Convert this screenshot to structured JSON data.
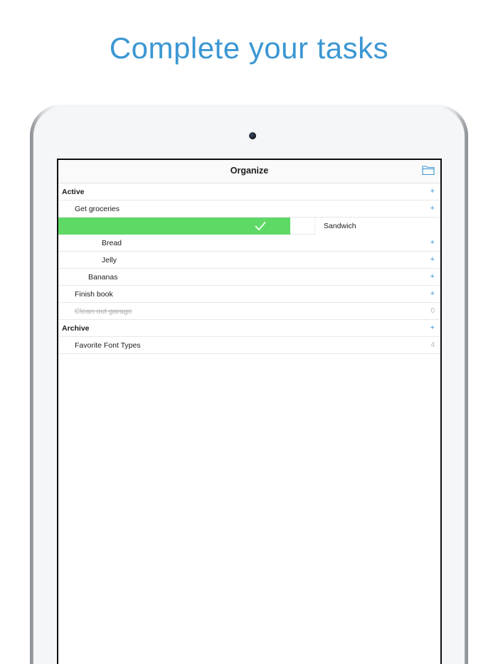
{
  "headline": "Complete your tasks",
  "app": {
    "title": "Organize",
    "folder_icon": "folder-icon"
  },
  "colors": {
    "accent": "#3b97d3",
    "swipe_complete": "#5fd966"
  },
  "list": {
    "active_header": "Active",
    "active_add": "+",
    "groceries": {
      "label": "Get groceries",
      "add": "+"
    },
    "sandwich": {
      "label": "Sandwich",
      "swipe_icon": "check-icon"
    },
    "bread": {
      "label": "Bread",
      "add": "+"
    },
    "jelly": {
      "label": "Jelly",
      "add": "+"
    },
    "bananas": {
      "label": "Bananas",
      "add": "+"
    },
    "finish_book": {
      "label": "Finish book",
      "add": "+"
    },
    "clean_garage": {
      "label": "Clean out garage",
      "count": "0"
    },
    "archive_header": "Archive",
    "archive_add": "+",
    "favorite_fonts": {
      "label": "Favorite Font Types",
      "count": "4"
    }
  }
}
